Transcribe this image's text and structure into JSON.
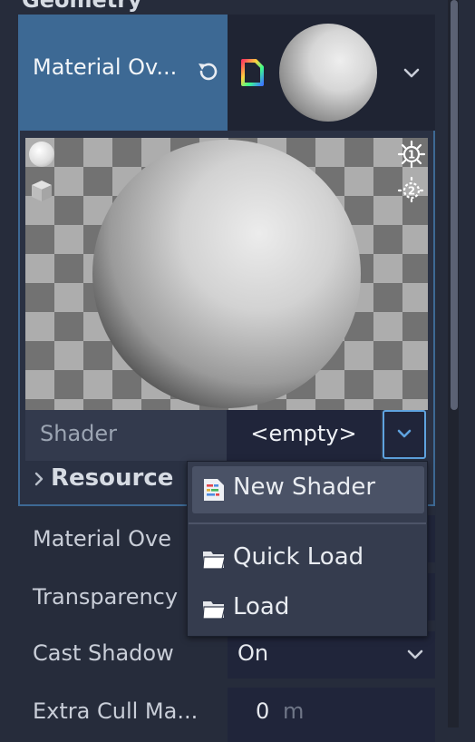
{
  "inspector": {
    "section_title": "Geometry",
    "material_override_label": "Material Ov...",
    "shader": {
      "label": "Shader",
      "value": "<empty>"
    },
    "resource_label": "Resource",
    "properties": [
      {
        "label": "Material Ove",
        "value": ""
      },
      {
        "label": "Transparency",
        "value": ""
      },
      {
        "label": "Cast Shadow",
        "value": "On"
      },
      {
        "label": "Extra Cull Ma...",
        "value": "0",
        "unit": "m"
      }
    ]
  },
  "dropdown_menu": {
    "items": [
      {
        "label": "New Shader",
        "icon": "shader-icon"
      },
      {
        "label": "Quick Load",
        "icon": "folder-icon"
      },
      {
        "label": "Load",
        "icon": "folder-icon"
      }
    ]
  },
  "colors": {
    "background": "#262c3b",
    "selected_row": "#3d6994",
    "focus_border": "#5fa3df",
    "menu_background": "#353c4e",
    "menu_highlight": "#4a5266"
  }
}
